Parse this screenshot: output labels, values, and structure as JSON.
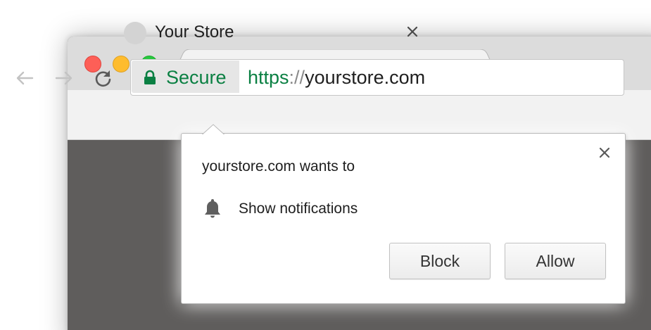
{
  "tab": {
    "title": "Your Store"
  },
  "address_bar": {
    "security_label": "Secure",
    "url_scheme": "https",
    "url_separator": "://",
    "url_host": "yourstore.com"
  },
  "permission_prompt": {
    "heading": "yourstore.com wants to",
    "permission_icon": "bell-icon",
    "permission_label": "Show notifications",
    "block_label": "Block",
    "allow_label": "Allow"
  },
  "colors": {
    "secure_green": "#0b8043",
    "close_red": "#fd5f57",
    "minimize_yellow": "#febc2e",
    "zoom_green": "#28c840"
  }
}
